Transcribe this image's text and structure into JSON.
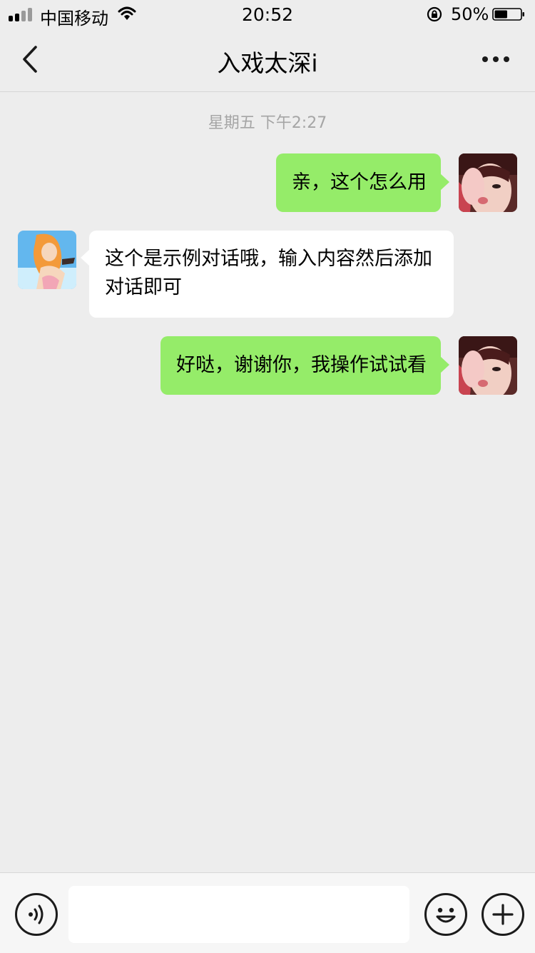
{
  "status_bar": {
    "carrier": "中国移动",
    "time": "20:52",
    "battery_percent": "50%",
    "battery_level": 0.5
  },
  "nav": {
    "title": "入戏太深i"
  },
  "chat": {
    "timestamp": "星期五 下午2:27",
    "messages": [
      {
        "sender": "self",
        "text": "亲，这个怎么用"
      },
      {
        "sender": "other",
        "text": "这个是示例对话哦，输入内容然后添加对话即可"
      },
      {
        "sender": "self",
        "text": "好哒，谢谢你，我操作试试看"
      }
    ]
  },
  "input_bar": {
    "message_value": "",
    "icons": [
      "voice-icon",
      "emoji-icon",
      "plus-icon"
    ]
  },
  "colors": {
    "self_bubble": "#95ec69",
    "other_bubble": "#ffffff",
    "background": "#ededed"
  }
}
